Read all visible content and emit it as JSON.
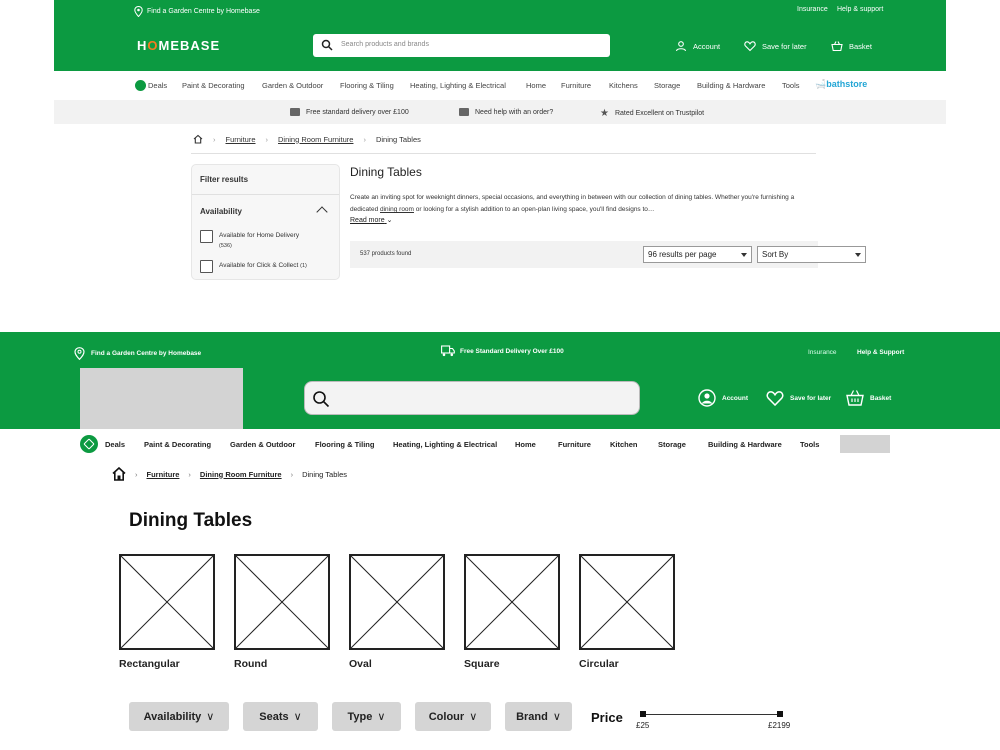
{
  "top": {
    "utility": {
      "find_centre": "Find a Garden Centre by Homebase",
      "insurance": "Insurance",
      "help": "Help & support"
    },
    "logo": {
      "pre": "H",
      "o": "O",
      "post": "MEBASE"
    },
    "search": {
      "placeholder": "Search products and brands"
    },
    "header": {
      "account": "Account",
      "save_for_later": "Save for later",
      "basket": "Basket"
    },
    "nav": [
      "Deals",
      "Paint & Decorating",
      "Garden & Outdoor",
      "Flooring & Tiling",
      "Heating, Lighting & Electrical",
      "Home",
      "Furniture",
      "Kitchens",
      "Storage",
      "Building & Hardware",
      "Tools"
    ],
    "bathstore": "bathstore",
    "benefits": [
      "Free standard delivery over £100",
      "Need help with an order?",
      "Rated Excellent on Trustpilot"
    ],
    "breadcrumb": [
      "Furniture",
      "Dining Room Furniture",
      "Dining Tables"
    ],
    "filter": {
      "heading": "Filter results",
      "availability": "Availability",
      "options": [
        {
          "label": "Available for Home Delivery",
          "count": "(536)"
        },
        {
          "label": "Available for Click & Collect",
          "count": "(1)"
        }
      ]
    },
    "page_title": "Dining Tables",
    "description": {
      "part1": "Create an inviting spot for weeknight dinners, special occasions, and everything in between with our collection of dining tables. Whether you're furnishing a dedicated ",
      "link": "dining room",
      "part2": " or looking for a stylish addition to an open-plan living space, you'll find designs to…"
    },
    "read_more": "Read more",
    "results": {
      "count": "537 products found",
      "per_page": "96 results per page",
      "sort": "Sort By"
    }
  },
  "wire": {
    "utility": {
      "find_centre": "Find a Garden Centre by Homebase",
      "delivery": "Free Standard Delivery Over £100",
      "insurance": "Insurance",
      "help": "Help & Support"
    },
    "header": {
      "account": "Account",
      "save_for_later": "Save for later",
      "basket": "Basket"
    },
    "nav": [
      "Deals",
      "Paint & Decorating",
      "Garden & Outdoor",
      "Flooring & Tiling",
      "Heating, Lighting & Electrical",
      "Home",
      "Furniture",
      "Kitchen",
      "Storage",
      "Building & Hardware",
      "Tools"
    ],
    "breadcrumb": [
      "Furniture",
      "Dining Room Furniture",
      "Dining Tables"
    ],
    "page_title": "Dining Tables",
    "categories": [
      "Rectangular",
      "Round",
      "Oval",
      "Square",
      "Circular"
    ],
    "filters": [
      "Availability",
      "Seats",
      "Type",
      "Colour",
      "Brand"
    ],
    "chevron": "∨",
    "price": {
      "label": "Price",
      "min": "£25",
      "max": "£2199"
    }
  },
  "colors": {
    "brand_green": "#0c9a41",
    "accent_orange": "#f47b20",
    "bathstore_blue": "#23a6d5"
  }
}
